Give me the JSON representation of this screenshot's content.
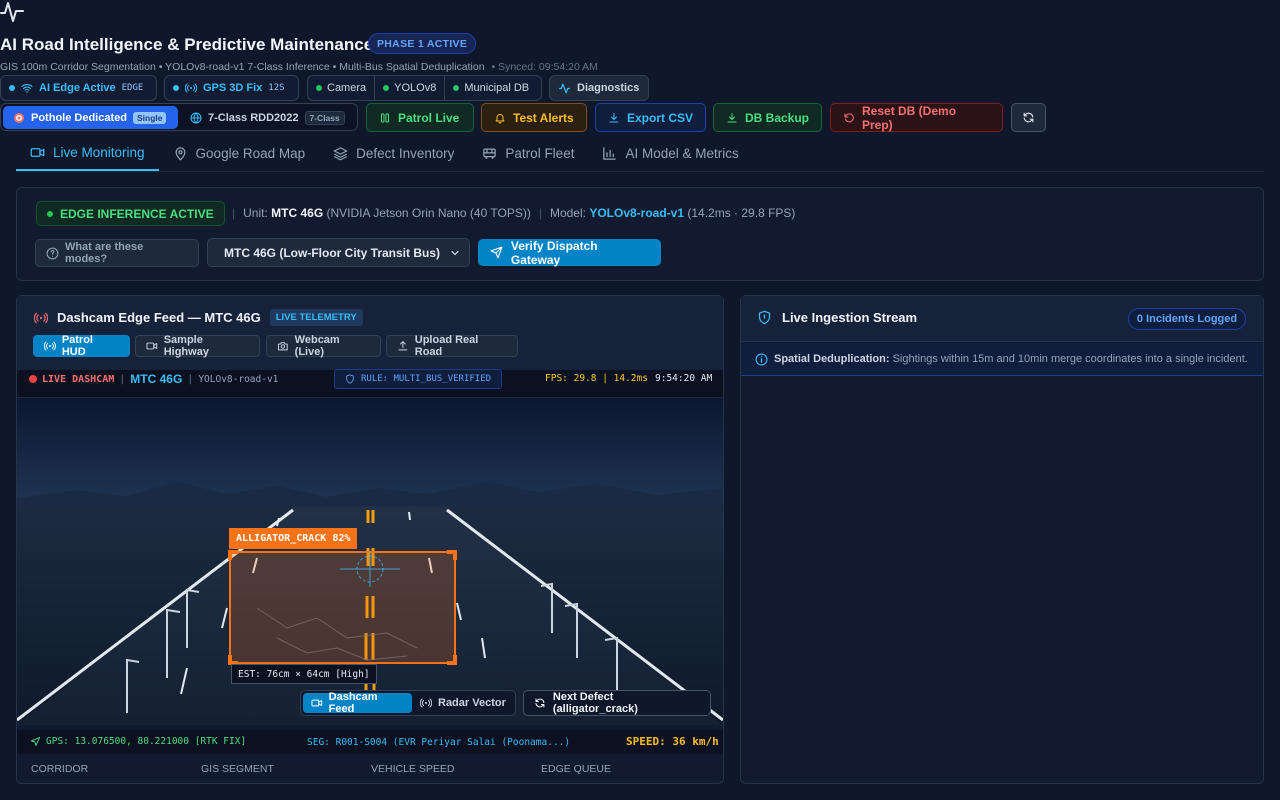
{
  "header": {
    "title": "AI Road Intelligence & Predictive Maintenance",
    "phase_badge": "PHASE 1 ACTIVE",
    "subtitle": "GIS 100m Corridor Segmentation • YOLOv8-road-v1 7-Class Inference • Multi-Bus Spatial Deduplication",
    "synced": "• Synced: 09:54:20 AM"
  },
  "status": {
    "ai_edge": {
      "label": "AI Edge Active",
      "tag": "EDGE"
    },
    "gps": {
      "label": "GPS 3D Fix",
      "tag": "12S"
    },
    "services": [
      {
        "label": "Camera"
      },
      {
        "label": "YOLOv8"
      },
      {
        "label": "Municipal DB"
      }
    ],
    "diagnostics": "Diagnostics"
  },
  "toolbar": {
    "mode_active": {
      "label": "Pothole Dedicated",
      "badge": "Single"
    },
    "mode_other": {
      "label": "7-Class RDD2022",
      "badge": "7-Class"
    },
    "patrol_live": "Patrol Live",
    "test_alerts": "Test Alerts",
    "export_csv": "Export CSV",
    "db_backup": "DB Backup",
    "reset_db": "Reset DB (Demo Prep)"
  },
  "tabs": [
    {
      "label": "Live Monitoring"
    },
    {
      "label": "Google Road Map"
    },
    {
      "label": "Defect Inventory"
    },
    {
      "label": "Patrol Fleet"
    },
    {
      "label": "AI Model & Metrics"
    }
  ],
  "inference": {
    "badge": "EDGE INFERENCE ACTIVE",
    "unit_label": "Unit:",
    "unit": "MTC 46G",
    "unit_hw": "(NVIDIA Jetson Orin Nano (40 TOPS))",
    "model_label": "Model:",
    "model": "YOLOv8-road-v1",
    "model_perf": "(14.2ms · 29.8 FPS)",
    "modes_help": "What are these modes?",
    "vehicle_select": "MTC 46G (Low-Floor City Transit Bus)",
    "verify_button": "Verify Dispatch Gateway"
  },
  "dashcam": {
    "title": "Dashcam Edge Feed — MTC 46G",
    "telemetry_badge": "LIVE TELEMETRY",
    "sources": [
      {
        "label": "Patrol HUD"
      },
      {
        "label": "Sample Highway"
      },
      {
        "label": "Webcam (Live)"
      },
      {
        "label": "Upload Real Road"
      }
    ],
    "hud": {
      "live": "LIVE DASHCAM",
      "unit": "MTC 46G",
      "model": "YOLOv8-road-v1",
      "rule": "RULE: MULTI_BUS_VERIFIED",
      "fps": "FPS: 29.8 | 14.2ms",
      "time": "9:54:20 AM"
    },
    "detection": {
      "label": "ALLIGATOR_CRACK 82%",
      "estimate": "EST: 76cm × 64cm [High]"
    },
    "view_toggle": {
      "active": "Dashcam Feed",
      "other": "Radar Vector"
    },
    "next_defect": "Next Defect (alligator_crack)",
    "footer": {
      "gps": "GPS: 13.076500, 80.221000 [RTK FIX]",
      "segment": "SEG: R001-S004 (EVR Periyar Salai (Poonama...)",
      "speed": "SPEED: 36 km/h"
    },
    "meta": [
      {
        "label": "CORRIDOR"
      },
      {
        "label": "GIS SEGMENT"
      },
      {
        "label": "VEHICLE SPEED"
      },
      {
        "label": "EDGE QUEUE"
      }
    ]
  },
  "ingestion": {
    "title": "Live Ingestion Stream",
    "count": "0 Incidents Logged",
    "dedup_label": "Spatial Deduplication:",
    "dedup_text": "Sightings within 15m and 10min merge coordinates into a single incident."
  },
  "colors": {
    "accent": "#38bdf8",
    "success": "#22c55e",
    "warning": "#f59e0b",
    "danger": "#f87171",
    "detection": "#f97316"
  }
}
